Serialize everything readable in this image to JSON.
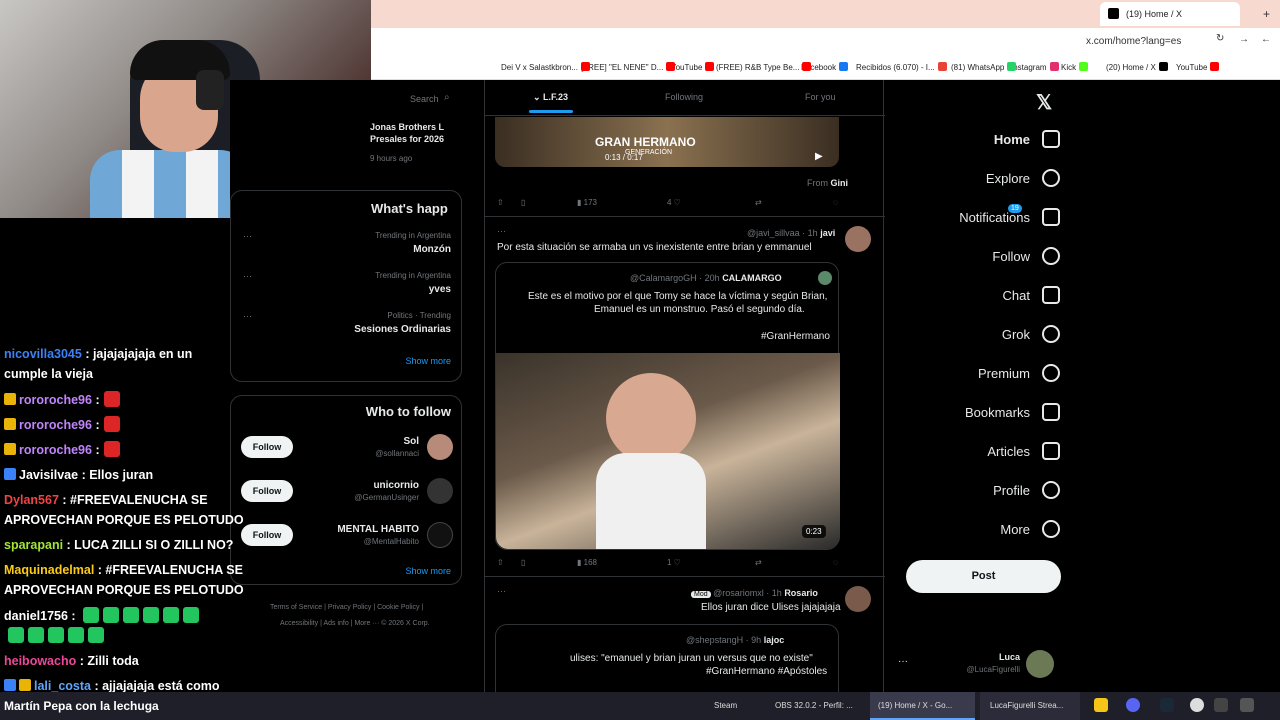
{
  "browser": {
    "active_tab": "(19) Home / X",
    "url": "x.com/home?lang=es",
    "bookmarks": [
      "YouTube",
      "(20) Home / X",
      "Kick",
      "Instagram",
      "(81) WhatsApp",
      "Recibidos (6.070) - I...",
      "Facebook",
      "(FREE) R&B Type Be...",
      "YouTube",
      "[FREE] \"EL NENE\" D...",
      "Dei V x Salastkbron..."
    ]
  },
  "chat": [
    {
      "user": "nicovilla3045",
      "color": "#3b82f6",
      "text": ": jajajajajaja en un",
      "text2": "cumple la vieja"
    },
    {
      "user": "rororoche96",
      "color": "#c084fc",
      "text": ":",
      "emote": true
    },
    {
      "user": "rororoche96",
      "color": "#c084fc",
      "text": ":",
      "emote": true
    },
    {
      "user": "rororoche96",
      "color": "#c084fc",
      "text": ":",
      "emote": true
    },
    {
      "user": "Javisilvae",
      "color": "#e7e9ea",
      "text": ": Ellos juran"
    },
    {
      "user": "Dylan567",
      "color": "#ef4444",
      "text": ": #FREEVALENUCHA SE",
      "text2": "APROVECHAN PORQUE ES PELOTUDO"
    },
    {
      "user": "sparapani",
      "color": "#a3e635",
      "text": ": LUCA ZILLI SI O ZILLI NO?"
    },
    {
      "user": "Maquinadelmal",
      "color": "#facc15",
      "text": ": #FREEVALENUCHA SE",
      "text2": "APROVECHAN PORQUE ES PELOTUDO"
    },
    {
      "user": "daniel1756",
      "color": "#e7e9ea",
      "text": ":"
    },
    {
      "user": "heibowacho",
      "color": "#ec4899",
      "text": ": Zilli toda"
    },
    {
      "user": "lali_costa",
      "color": "#60a5fa",
      "text": ": ajjajajaja está como"
    },
    {
      "user": "",
      "color": "#e7e9ea",
      "text": "Martín Pepa con la lechuga"
    }
  ],
  "nav": {
    "items": [
      "Home",
      "Explore",
      "Notifications",
      "Follow",
      "Chat",
      "Grok",
      "Premium",
      "Bookmarks",
      "Articles",
      "Profile",
      "More"
    ],
    "notif_badge": "19",
    "post": "Post",
    "account_name": "Luca",
    "account_handle": "@LucaFigurelli"
  },
  "timeline": {
    "tabs": [
      "For you",
      "Following",
      "L.F.23"
    ],
    "video_banner": "GRAN HERMANO",
    "video_sub": "GENERACIÓN",
    "video_time": "0:13 / 0:17",
    "from": "From",
    "from_name": "Gini",
    "t1_stats": {
      "views": "173",
      "likes": "4"
    },
    "t2": {
      "name": "javi",
      "handle": "@javi_sillvaa · 1h",
      "text": "Por esta situación se armaba un vs inexistente entre brian y emmanuel",
      "quote_name": "CALAMARGO",
      "quote_handle": "@CalamargoGH · 20h",
      "quote_l1": "Este es el motivo por el que Tomy se hace la víctima y según Brian,",
      "quote_l2": "Emanuel es un monstruo.  Pasó el segundo día.",
      "quote_tag": "#GranHermano",
      "video_len": "0:23",
      "views": "168",
      "likes": "1"
    },
    "t3": {
      "name": "Rosario",
      "handle": "@rosariomxl · 1h",
      "badge": "Mod",
      "text": "Ellos juran dice Ulises jajajajaja",
      "quote_name": "lajoc",
      "quote_handle": "@shepstangH · 9h",
      "quote_l1": "ulises: \"emanuel y brian juran un versus que no existe\"",
      "quote_l2": "#GranHermano #Apóstoles"
    }
  },
  "side": {
    "search": "Search",
    "trend_top_l1": "Jonas Brothers L",
    "trend_top_l2": "Presales for 2026",
    "trend_top_l3": "9 hours ago",
    "whats": "What's happ",
    "trends": [
      {
        "ctx": "Trending in Argentina",
        "name": "Monzón"
      },
      {
        "ctx": "Trending in Argentina",
        "name": "yves"
      },
      {
        "ctx": "Politics · Trending",
        "name": "Sesiones Ordinarias"
      }
    ],
    "show_more": "Show more",
    "who": "Who to follow",
    "follow_label": "Follow",
    "suggestions": [
      {
        "name": "Sol",
        "handle": "@sollannaci"
      },
      {
        "name": "unicornio",
        "handle": "@GermanUsinger"
      },
      {
        "name": "MENTAL HABITO",
        "handle": "@MentalHabito"
      }
    ],
    "footer_l1": "Terms of Service | Privacy Policy | Cookie Policy |",
    "footer_l2": "Accessibility | Ads info | More ··· © 2026 X Corp."
  },
  "taskbar": [
    "Steam",
    "OBS 32.0.2 - Perfil: ...",
    "(19) Home / X - Go...",
    "LucaFigurelli Strea..."
  ],
  "colors": {
    "accent": "#1d9bf0",
    "bg": "#000000",
    "border": "#2f3336",
    "muted": "#71767b"
  }
}
